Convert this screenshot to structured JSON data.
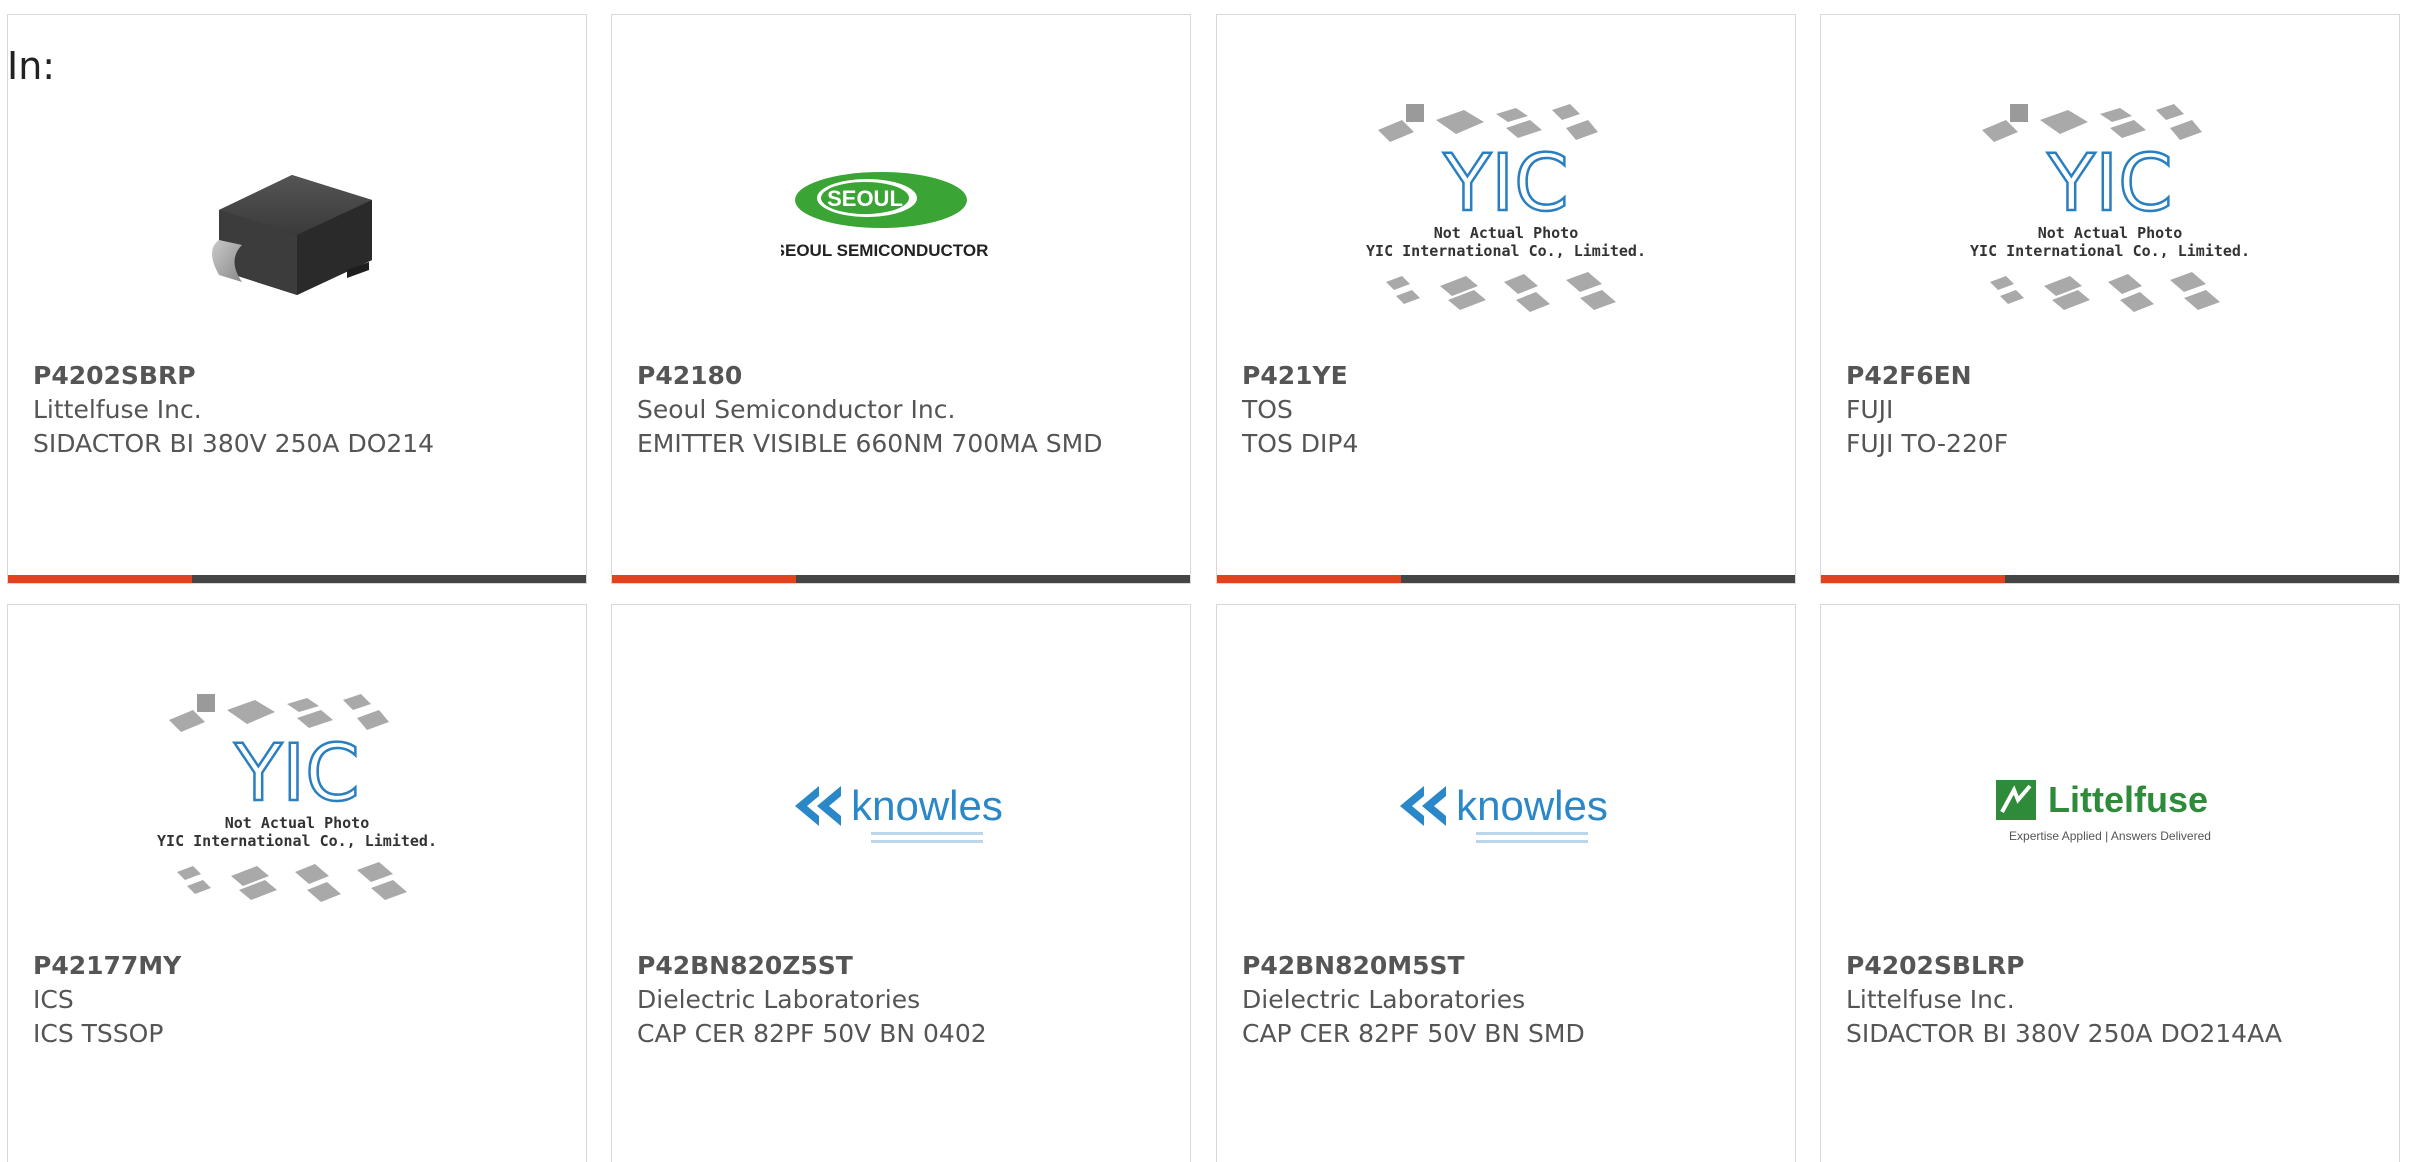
{
  "header": {
    "label": "In:"
  },
  "colors": {
    "accent": "#e5411c",
    "bar": "#454545",
    "text": "#555555",
    "border": "#d9d9d9"
  },
  "products": [
    {
      "part": "P4202SBRP",
      "manufacturer": "Littelfuse Inc.",
      "description": "SIDACTOR BI 380V 250A DO214",
      "image": "diode-package-photo"
    },
    {
      "part": "P42180",
      "manufacturer": "Seoul Semiconductor Inc.",
      "description": "EMITTER VISIBLE 660NM 700MA SMD",
      "image": "seoul-semiconductor-logo",
      "logo_text": "SEOUL",
      "logo_sub": "SEOUL SEMICONDUCTOR"
    },
    {
      "part": "P421YE",
      "manufacturer": "TOS",
      "description": "TOS DIP4",
      "image": "yic-placeholder",
      "placeholder_line1": "Not Actual Photo",
      "placeholder_line2": "YIC International Co., Limited.",
      "placeholder_logo": "YIC"
    },
    {
      "part": "P42F6EN",
      "manufacturer": "FUJI",
      "description": "FUJI TO-220F",
      "image": "yic-placeholder",
      "placeholder_line1": "Not Actual Photo",
      "placeholder_line2": "YIC International Co., Limited.",
      "placeholder_logo": "YIC"
    },
    {
      "part": "P42177MY",
      "manufacturer": "ICS",
      "description": "ICS TSSOP",
      "image": "yic-placeholder",
      "placeholder_line1": "Not Actual Photo",
      "placeholder_line2": "YIC International Co., Limited.",
      "placeholder_logo": "YIC"
    },
    {
      "part": "P42BN820Z5ST",
      "manufacturer": "Dielectric Laboratories",
      "description": "CAP CER 82PF 50V BN 0402",
      "image": "knowles-logo",
      "logo_text": "knowles"
    },
    {
      "part": "P42BN820M5ST",
      "manufacturer": "Dielectric Laboratories",
      "description": "CAP CER 82PF 50V BN SMD",
      "image": "knowles-logo",
      "logo_text": "knowles"
    },
    {
      "part": "P4202SBLRP",
      "manufacturer": "Littelfuse Inc.",
      "description": "SIDACTOR BI 380V 250A DO214AA",
      "image": "littelfuse-logo",
      "logo_text": "Littelfuse",
      "logo_sub": "Expertise Applied | Answers Delivered"
    }
  ]
}
